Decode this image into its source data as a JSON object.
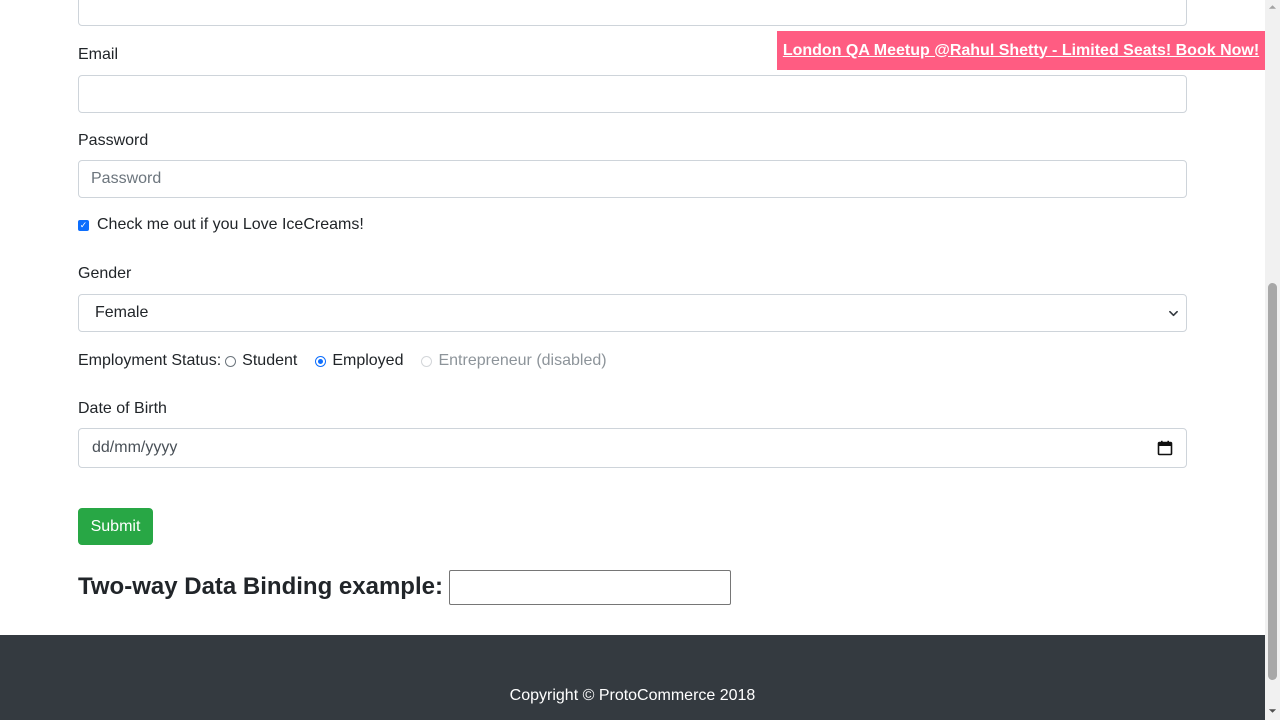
{
  "promo": {
    "text": "London QA Meetup @Rahul Shetty - Limited Seats! Book Now!"
  },
  "form": {
    "top_field_value": "",
    "email_label": "Email",
    "email_value": "",
    "password_label": "Password",
    "password_placeholder": "Password",
    "checkbox_label": "Check me out if you Love IceCreams!",
    "checkbox_checked": true,
    "gender_label": "Gender",
    "gender_selected": "Female",
    "employment_label": "Employment Status:",
    "employment_options": [
      {
        "label": "Student",
        "checked": false,
        "disabled": false
      },
      {
        "label": "Employed",
        "checked": true,
        "disabled": false
      },
      {
        "label": "Entrepreneur (disabled)",
        "checked": false,
        "disabled": true
      }
    ],
    "dob_label": "Date of Birth",
    "dob_placeholder": "dd/mm/yyyy",
    "submit_label": "Submit"
  },
  "binding": {
    "title": "Two-way Data Binding example:",
    "value": ""
  },
  "footer": {
    "text": "Copyright © ProtoCommerce 2018"
  },
  "colors": {
    "promo_bg": "#ff5c82",
    "submit_bg": "#28a745",
    "footer_bg": "#343a40",
    "accent": "#0d6efd"
  },
  "icons": {
    "select": "chevron-down-icon",
    "date": "calendar-icon",
    "check": "checkmark-icon"
  }
}
